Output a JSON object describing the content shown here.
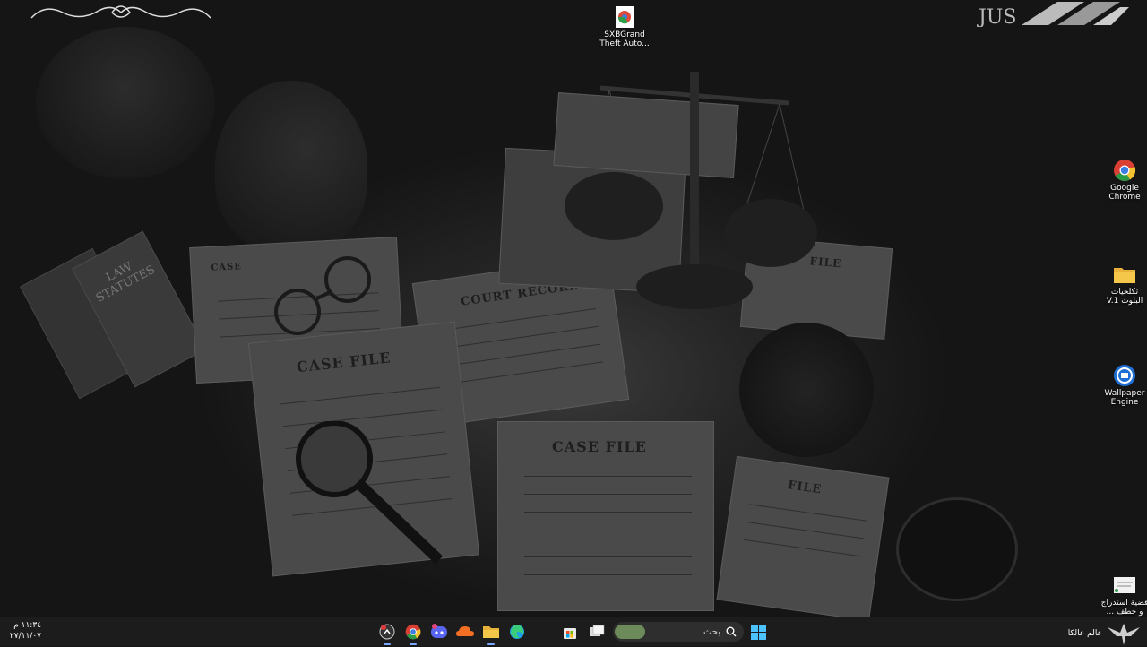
{
  "desktop": {
    "icons": [
      {
        "id": "sxb",
        "label": "SXBGrand\nTheft Auto..."
      },
      {
        "id": "chrome",
        "label": "Google\nChrome"
      },
      {
        "id": "folder",
        "label": "تكلحيات\nV.1 البلوث"
      },
      {
        "id": "wallpaper",
        "label": "Wallpaper\nEngine"
      },
      {
        "id": "doc",
        "label": "قضية استدراج\n... و خطف"
      }
    ],
    "wallpaper_texts": {
      "case_file_1": "CASE FILE",
      "case_file_2": "CASE FILE",
      "court_record": "COURT RECORD",
      "case": "CASE",
      "law_statutes": "LAW STATUTES",
      "file": "FILE",
      "file2": "FILE"
    },
    "corner_logo_text": "JUS"
  },
  "taskbar": {
    "clock_time": "١١:٣٤ م",
    "clock_date": "٢٧/١١/٠٧",
    "search_placeholder": "بحث",
    "profile_label": "عالم عالكا",
    "apps": [
      {
        "name": "app-red-circle"
      },
      {
        "name": "chrome"
      },
      {
        "name": "discord"
      },
      {
        "name": "soundcloud"
      },
      {
        "name": "file-explorer"
      },
      {
        "name": "edge"
      },
      {
        "name": "store"
      },
      {
        "name": "task-view"
      }
    ]
  }
}
